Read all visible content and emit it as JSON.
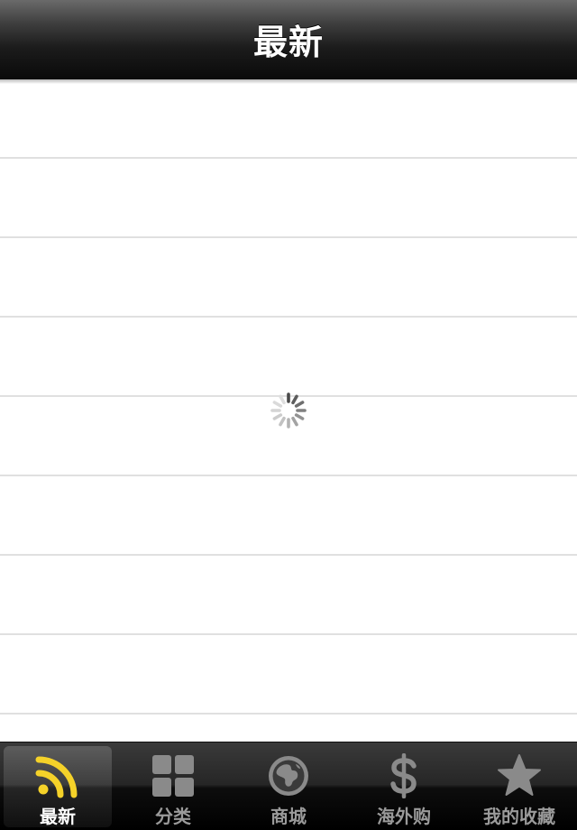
{
  "navbar": {
    "title": "最新"
  },
  "content": {
    "state": "loading",
    "row_count": 9
  },
  "tabbar": {
    "selected_index": 0,
    "tabs": [
      {
        "label": "最新",
        "icon": "rss-icon"
      },
      {
        "label": "分类",
        "icon": "grid-icon"
      },
      {
        "label": "商城",
        "icon": "globe-icon"
      },
      {
        "label": "海外购",
        "icon": "dollar-icon"
      },
      {
        "label": "我的收藏",
        "icon": "star-icon"
      }
    ]
  },
  "colors": {
    "selected_icon": "#f5d229",
    "inactive_icon": "#8a8a8a",
    "row_separator": "#e0e0e0"
  }
}
